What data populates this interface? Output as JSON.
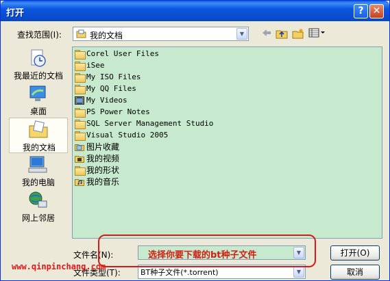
{
  "window": {
    "title": "打开"
  },
  "title_buttons": {
    "help": "?",
    "close": "✕"
  },
  "look_in": {
    "label": "查找范围(I):",
    "value": "我的文档"
  },
  "toolbar": [
    {
      "name": "back-icon",
      "glyph": "⇦"
    },
    {
      "name": "up-folder-icon",
      "glyph": "⬆"
    },
    {
      "name": "new-folder-icon",
      "glyph": "✱"
    },
    {
      "name": "view-menu-icon",
      "glyph": "▦▾"
    }
  ],
  "places": [
    {
      "label": "我最近的文档",
      "icon": "recent-documents-icon"
    },
    {
      "label": "桌面",
      "icon": "desktop-icon"
    },
    {
      "label": "我的文档",
      "icon": "my-documents-icon"
    },
    {
      "label": "我的电脑",
      "icon": "my-computer-icon"
    },
    {
      "label": "网上邻居",
      "icon": "network-places-icon"
    }
  ],
  "files": [
    {
      "name": "Corel User Files",
      "icon": "folder-icon"
    },
    {
      "name": "iSee",
      "icon": "folder-icon"
    },
    {
      "name": "My ISO Files",
      "icon": "folder-icon"
    },
    {
      "name": "My QQ Files",
      "icon": "folder-icon"
    },
    {
      "name": "My Videos",
      "icon": "video-folder-icon"
    },
    {
      "name": "PS Power Notes",
      "icon": "folder-icon"
    },
    {
      "name": "SQL Server Management Studio",
      "icon": "folder-icon"
    },
    {
      "name": "Visual Studio 2005",
      "icon": "folder-icon"
    },
    {
      "name": "图片收藏",
      "icon": "pictures-folder-icon"
    },
    {
      "name": "我的视频",
      "icon": "video-folder-icon"
    },
    {
      "name": "我的形状",
      "icon": "folder-icon"
    },
    {
      "name": "我的音乐",
      "icon": "music-folder-icon"
    }
  ],
  "filename": {
    "label": "文件名(N):",
    "value": "选择你要下载的bt种子文件"
  },
  "filetype": {
    "label": "文件类型(T):",
    "value": "BT种子文件(*.torrent)"
  },
  "buttons": {
    "open": "打开(O)",
    "cancel": "取消"
  },
  "watermark": "www.qinpinchang.com",
  "colors": {
    "titlebar": "#0a4ccf",
    "list_bg": "#c7e9cd",
    "callout": "#d61a1a"
  }
}
